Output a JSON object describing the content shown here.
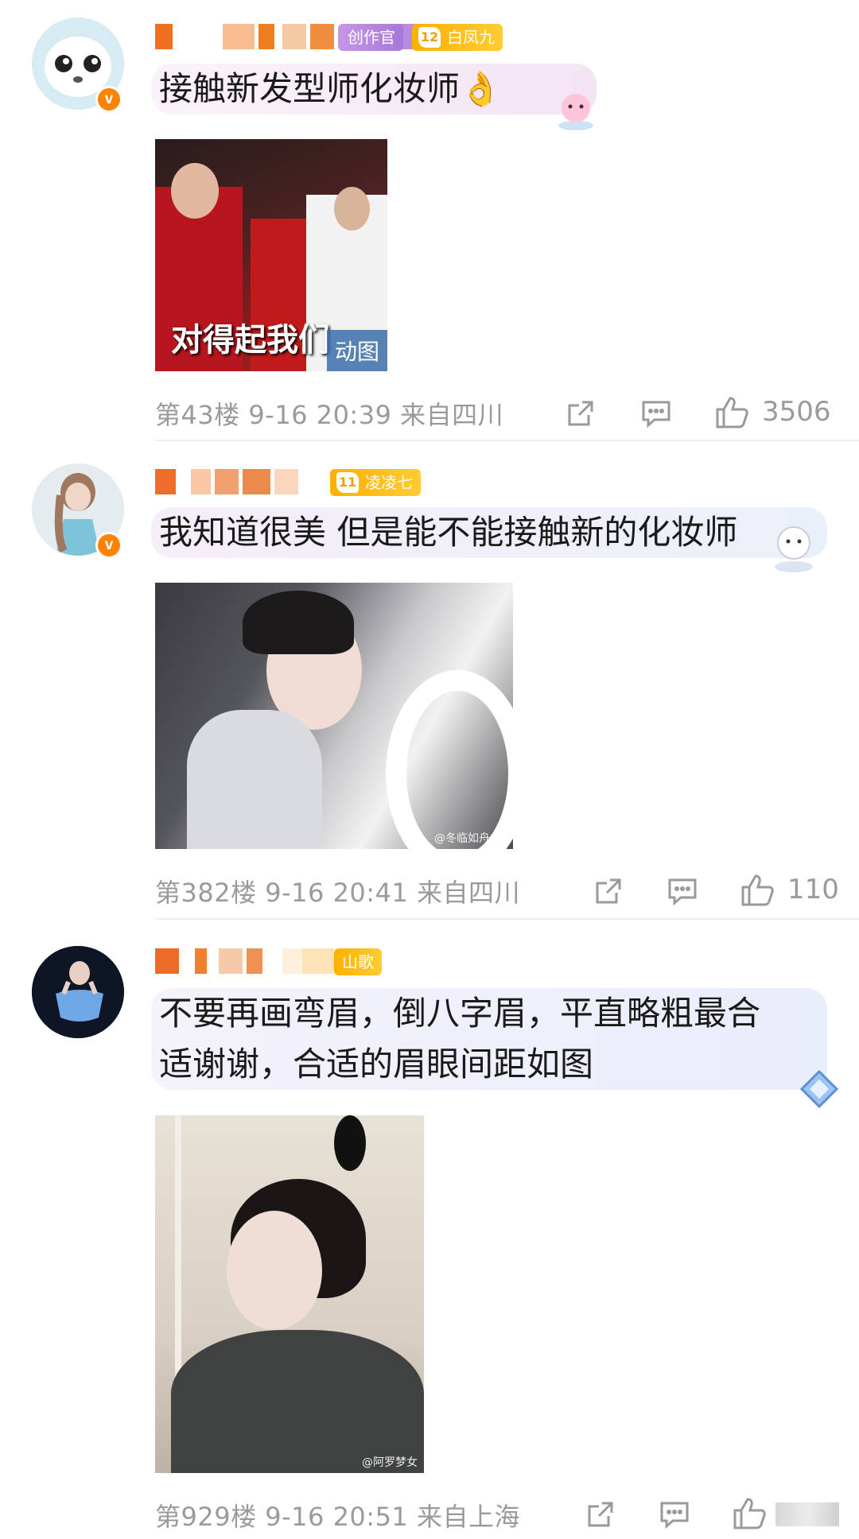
{
  "comments": [
    {
      "tag_prefix": "创作官",
      "tag_level": "12",
      "tag_name": "白凤九",
      "text": "接触新发型师化妆师👌",
      "image_caption": "对得起我们",
      "image_badge": "动图",
      "floor": "第43楼",
      "date": "9-16 20:39",
      "location": "来自四川",
      "likes": "3506"
    },
    {
      "tag_level": "11",
      "tag_name": "凌凌七",
      "text": "我知道很美 但是能不能接触新的化妆师",
      "image_watermark": "@冬临如舟曲_",
      "floor": "第382楼",
      "date": "9-16 20:41",
      "location": "来自四川",
      "likes": "110"
    },
    {
      "tag_name": "山歌",
      "text_line1": "不要再画弯眉，倒八字眉，平直略粗最合",
      "text_line2": "适谢谢，合适的眉眼间距如图",
      "image_watermark": "@阿罗梦女",
      "floor": "第929楼",
      "date": "9-16 20:51",
      "location": "来自上海"
    }
  ],
  "colors": {
    "accent": "#ff8200",
    "tag_gold": "#ffb000",
    "meta_gray": "#9a9a9a",
    "bubble_pink": "#f8eef8",
    "bubble_blue": "#eef1fb"
  },
  "icons": [
    "share-icon",
    "comment-icon",
    "like-icon",
    "verified-icon"
  ]
}
